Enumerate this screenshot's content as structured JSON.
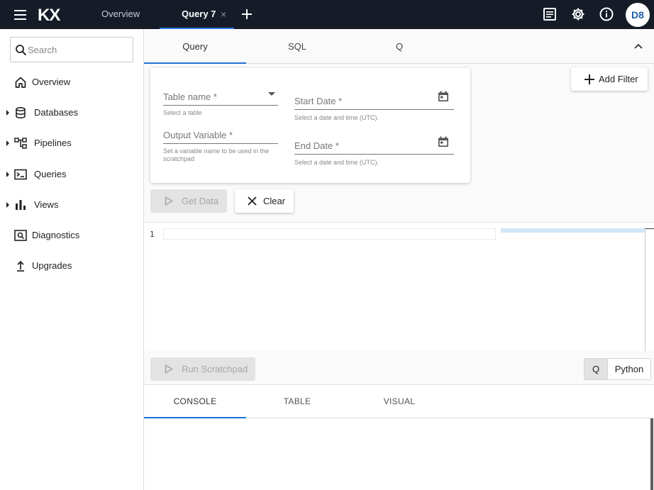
{
  "header": {
    "logo": "KX",
    "tabs": [
      {
        "label": "Overview"
      },
      {
        "label": "Query 7",
        "close": "×"
      }
    ],
    "avatar": "D8"
  },
  "sidebar": {
    "search_placeholder": "Search",
    "items": [
      {
        "label": "Overview",
        "icon": "home-icon",
        "expandable": false
      },
      {
        "label": "Databases",
        "icon": "database-icon",
        "expandable": true
      },
      {
        "label": "Pipelines",
        "icon": "pipeline-icon",
        "expandable": true
      },
      {
        "label": "Queries",
        "icon": "terminal-icon",
        "expandable": true
      },
      {
        "label": "Views",
        "icon": "bar-chart-icon",
        "expandable": true
      },
      {
        "label": "Diagnostics",
        "icon": "diagnostics-icon",
        "expandable": false
      },
      {
        "label": "Upgrades",
        "icon": "upload-icon",
        "expandable": false
      }
    ]
  },
  "query_tabs": {
    "tabs": [
      "Query",
      "SQL",
      "Q"
    ],
    "active": "Query"
  },
  "form": {
    "table_name": {
      "label": "Table name *",
      "hint": "Select a table"
    },
    "output_variable": {
      "label": "Output Variable *",
      "hint": "Set a variable name to be used in the scratchpad"
    },
    "start_date": {
      "label": "Start Date *",
      "hint": "Select a date and time (UTC)."
    },
    "end_date": {
      "label": "End Date *",
      "hint": "Select a date and time (UTC)."
    }
  },
  "actions": {
    "add_filter": "Add Filter",
    "get_data": "Get Data",
    "clear": "Clear",
    "run_scratchpad": "Run Scratchpad"
  },
  "editor": {
    "line_number": "1"
  },
  "language_toggle": {
    "options": [
      "Q",
      "Python"
    ],
    "selected": "Q"
  },
  "output_tabs": {
    "tabs": [
      "CONSOLE",
      "TABLE",
      "VISUAL"
    ],
    "active": "CONSOLE"
  },
  "colors": {
    "topbar_bg": "#151c28",
    "accent": "#1f6fd8",
    "avatar_text": "#1f5dab"
  }
}
